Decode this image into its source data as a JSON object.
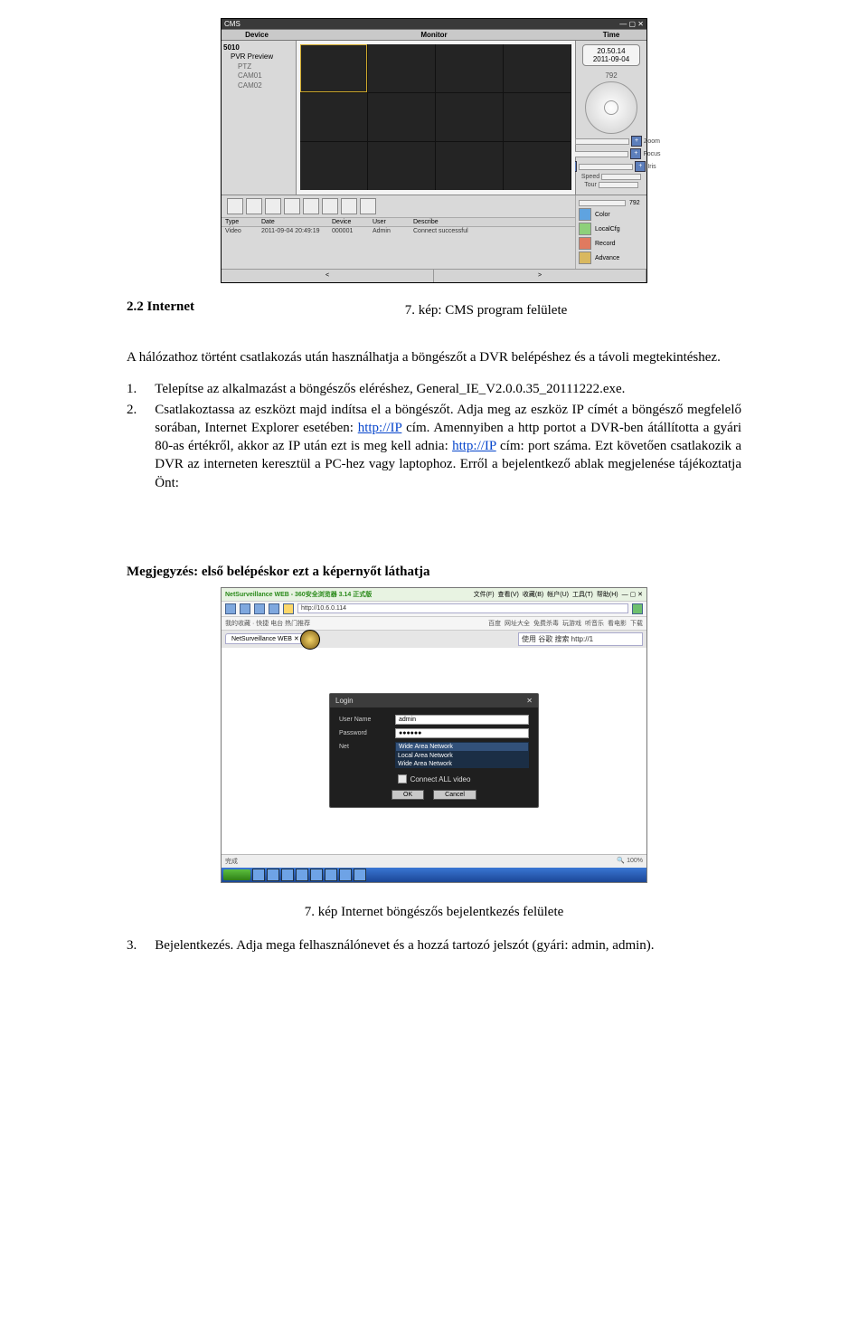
{
  "cms": {
    "app_title": "CMS",
    "col_device": "Device",
    "col_monitor": "Monitor",
    "col_time": "Time",
    "tree": {
      "root": "5010",
      "group": "PVR Preview",
      "items": [
        "PTZ",
        "CAM01",
        "CAM02"
      ]
    },
    "time_line1": "20.50.14",
    "time_line2": "2011-09-04",
    "ptz_num": "792",
    "ptz_labels": [
      "Zoom",
      "Focus",
      "Iris",
      "Speed"
    ],
    "tour": "Tour",
    "viewstrip_count": 8,
    "log_cols": [
      "Type",
      "Date",
      "Device",
      "User",
      "Describe"
    ],
    "log_row": [
      "Video",
      "2011-09-04 20:49:19",
      "000001",
      "Admin",
      "Connect successful"
    ],
    "side_right_num": "792",
    "side_items": [
      "Color",
      "LocalCfg",
      "Record",
      "Advance"
    ]
  },
  "text": {
    "section": "2.2 Internet",
    "caption1": "7. kép: CMS program felülete",
    "para_intro": "A hálózathoz történt csatlakozás után használhatja a böngészőt a DVR belépéshez és a távoli megtekintéshez.",
    "li1_a": "Telepítse az alkalmazást a böngészős eléréshez, General_IE_V2.0.0.35_20111222.exe.",
    "li2_a": "Csatlakoztassa az eszközt majd indítsa el a böngészőt. Adja meg az eszköz IP címét a böngésző megfelelő sorában, Internet Explorer esetében: ",
    "li2_b": " cím. Amennyiben a http portot a DVR-ben átállította a gyári 80-as értékről, akkor az IP után ezt is meg kell adnia: ",
    "li2_c": " cím: port száma. Ezt követően csatlakozik a DVR az interneten keresztül a PC-hez vagy laptophoz. Erről a bejelentkező ablak megjelenése tájékoztatja Önt:",
    "link": "http://IP",
    "note": "Megjegyzés: első belépéskor ezt a képernyőt láthatja",
    "caption2": "7. kép Internet böngészős bejelentkezés felülete",
    "li3": "Bejelentkezés. Adja mega felhasználónevet és a hozzá tartozó jelszót (gyári: admin, admin)."
  },
  "ie": {
    "title_row": "NetSurveillance WEB - 360安全浏览器 3.14 正式版",
    "menus": [
      "文件(F)",
      "查看(V)",
      "收藏(B)",
      "帐户(U)",
      "工具(T)",
      "帮助(H)"
    ],
    "url": "http://10.6.0.114",
    "fav_label": "我的收藏 · 快捷 电台 热门推荐",
    "bookmarks": [
      "百度",
      "网址大全",
      "免费杀毒",
      "玩游戏",
      "听音乐",
      "看电影",
      "下载"
    ],
    "tab": "NetSurveillance WEB",
    "search_hint": "使用 谷歌 搜索 http://1",
    "login": {
      "title": "Login",
      "user_label": "User Name",
      "user": "admin",
      "pass_label": "Password",
      "pass": "●●●●●●",
      "net_label": "Net",
      "net_sel": "Wide Area Network",
      "net_opt1": "Local Area Network",
      "net_opt2": "Wide Area Network",
      "conn": "Connect ALL video",
      "ok": "OK",
      "cancel": "Cancel"
    },
    "status_left": "完成",
    "status_right": "100%"
  }
}
